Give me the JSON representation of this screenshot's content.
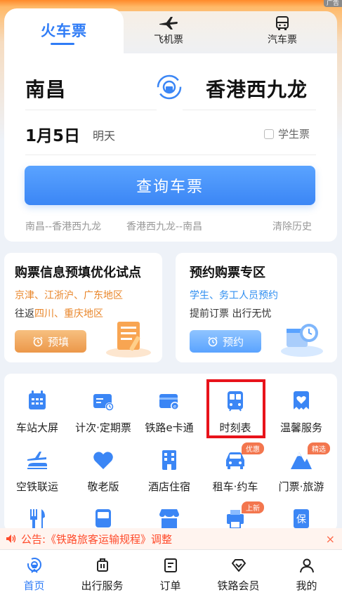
{
  "header": {
    "ad_tag": "广告"
  },
  "tabs": [
    {
      "label": "火车票",
      "icon": "train-icon",
      "active": true
    },
    {
      "label": "飞机票",
      "icon": "airplane-icon",
      "active": false
    },
    {
      "label": "汽车票",
      "icon": "bus-icon",
      "active": false
    }
  ],
  "booking": {
    "from_city": "南昌",
    "to_city": "香港西九龙",
    "date": "1月5日",
    "weekday": "明天",
    "student_label": "学生票",
    "student_checked": false,
    "search_label": "查询车票",
    "history": [
      "南昌--香港西九龙",
      "香港西九龙--南昌"
    ],
    "clear_history": "清除历史"
  },
  "promos": [
    {
      "title": "购票信息预填优化试点",
      "line1": "京津、江浙沪、广东地区",
      "line2_prefix": "往返",
      "line2_highlight": "四川、重庆地区",
      "button": "预填"
    },
    {
      "title": "预约购票专区",
      "line1": "学生、务工人员预约",
      "line2": "提前订票 出行无忧",
      "button": "预约"
    }
  ],
  "services": [
    {
      "label": "车站大屏",
      "icon": "station-screen-icon"
    },
    {
      "label": "计次·定期票",
      "icon": "ticket-card-icon"
    },
    {
      "label": "铁路e卡通",
      "icon": "ecard-icon"
    },
    {
      "label": "时刻表",
      "icon": "timetable-train-icon"
    },
    {
      "label": "温馨服务",
      "icon": "heart-service-icon"
    },
    {
      "label": "空铁联运",
      "icon": "air-rail-icon"
    },
    {
      "label": "敬老版",
      "icon": "heart-icon"
    },
    {
      "label": "酒店住宿",
      "icon": "hotel-icon"
    },
    {
      "label": "租车·约车",
      "icon": "car-icon",
      "badge": "优惠"
    },
    {
      "label": "门票·旅游",
      "icon": "mountain-icon",
      "badge": "精选"
    },
    {
      "label": "",
      "icon": "dining-icon"
    },
    {
      "label": "",
      "icon": "bus-front-icon"
    },
    {
      "label": "",
      "icon": "shop-icon"
    },
    {
      "label": "",
      "icon": "printer-icon",
      "badge": "上新"
    },
    {
      "label": "",
      "icon": "insurance-icon"
    }
  ],
  "notice": {
    "text": "公告:《铁路旅客运输规程》调整",
    "close": "×"
  },
  "nav": [
    {
      "label": "首页",
      "icon": "home-icon",
      "active": true
    },
    {
      "label": "出行服务",
      "icon": "luggage-icon"
    },
    {
      "label": "订单",
      "icon": "order-icon"
    },
    {
      "label": "铁路会员",
      "icon": "diamond-icon"
    },
    {
      "label": "我的",
      "icon": "user-icon"
    }
  ],
  "colors": {
    "accent": "#2f7cf6",
    "orange": "#e9862a",
    "warning": "#ff4b2b",
    "highlight": "#e8131b"
  }
}
